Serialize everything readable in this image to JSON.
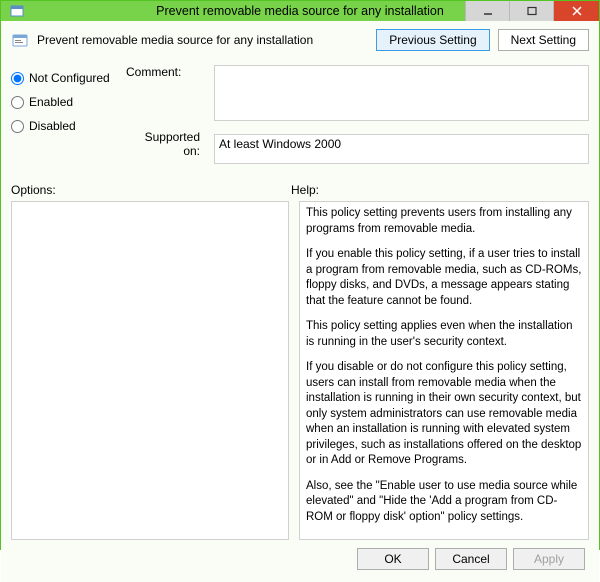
{
  "window": {
    "title": "Prevent removable media source for any installation"
  },
  "header": {
    "policy_name": "Prevent removable media source for any installation",
    "prev_button": "Previous Setting",
    "next_button": "Next Setting"
  },
  "radios": {
    "not_configured": "Not Configured",
    "enabled": "Enabled",
    "disabled": "Disabled",
    "selected": "not_configured"
  },
  "fields": {
    "comment_label": "Comment:",
    "comment_value": "",
    "supported_label": "Supported on:",
    "supported_value": "At least Windows 2000"
  },
  "labels": {
    "options": "Options:",
    "help": "Help:"
  },
  "help": {
    "p1": "This policy setting prevents users from installing any programs from removable media.",
    "p2": "If you enable this policy setting, if a user tries to install a program from removable media, such as CD-ROMs, floppy disks, and DVDs, a message appears stating that the feature cannot be found.",
    "p3": "This policy setting applies even when the installation is running in the user's security context.",
    "p4": "If you disable or do not configure this policy setting, users can install from removable media when the installation is running in their own security context, but only system administrators can use removable media when an installation is running with elevated system privileges, such as installations offered on the desktop or in Add or Remove Programs.",
    "p5": "Also, see the \"Enable user to use media source while elevated\" and \"Hide the 'Add a program from CD-ROM or floppy disk' option\" policy settings."
  },
  "buttons": {
    "ok": "OK",
    "cancel": "Cancel",
    "apply": "Apply"
  }
}
